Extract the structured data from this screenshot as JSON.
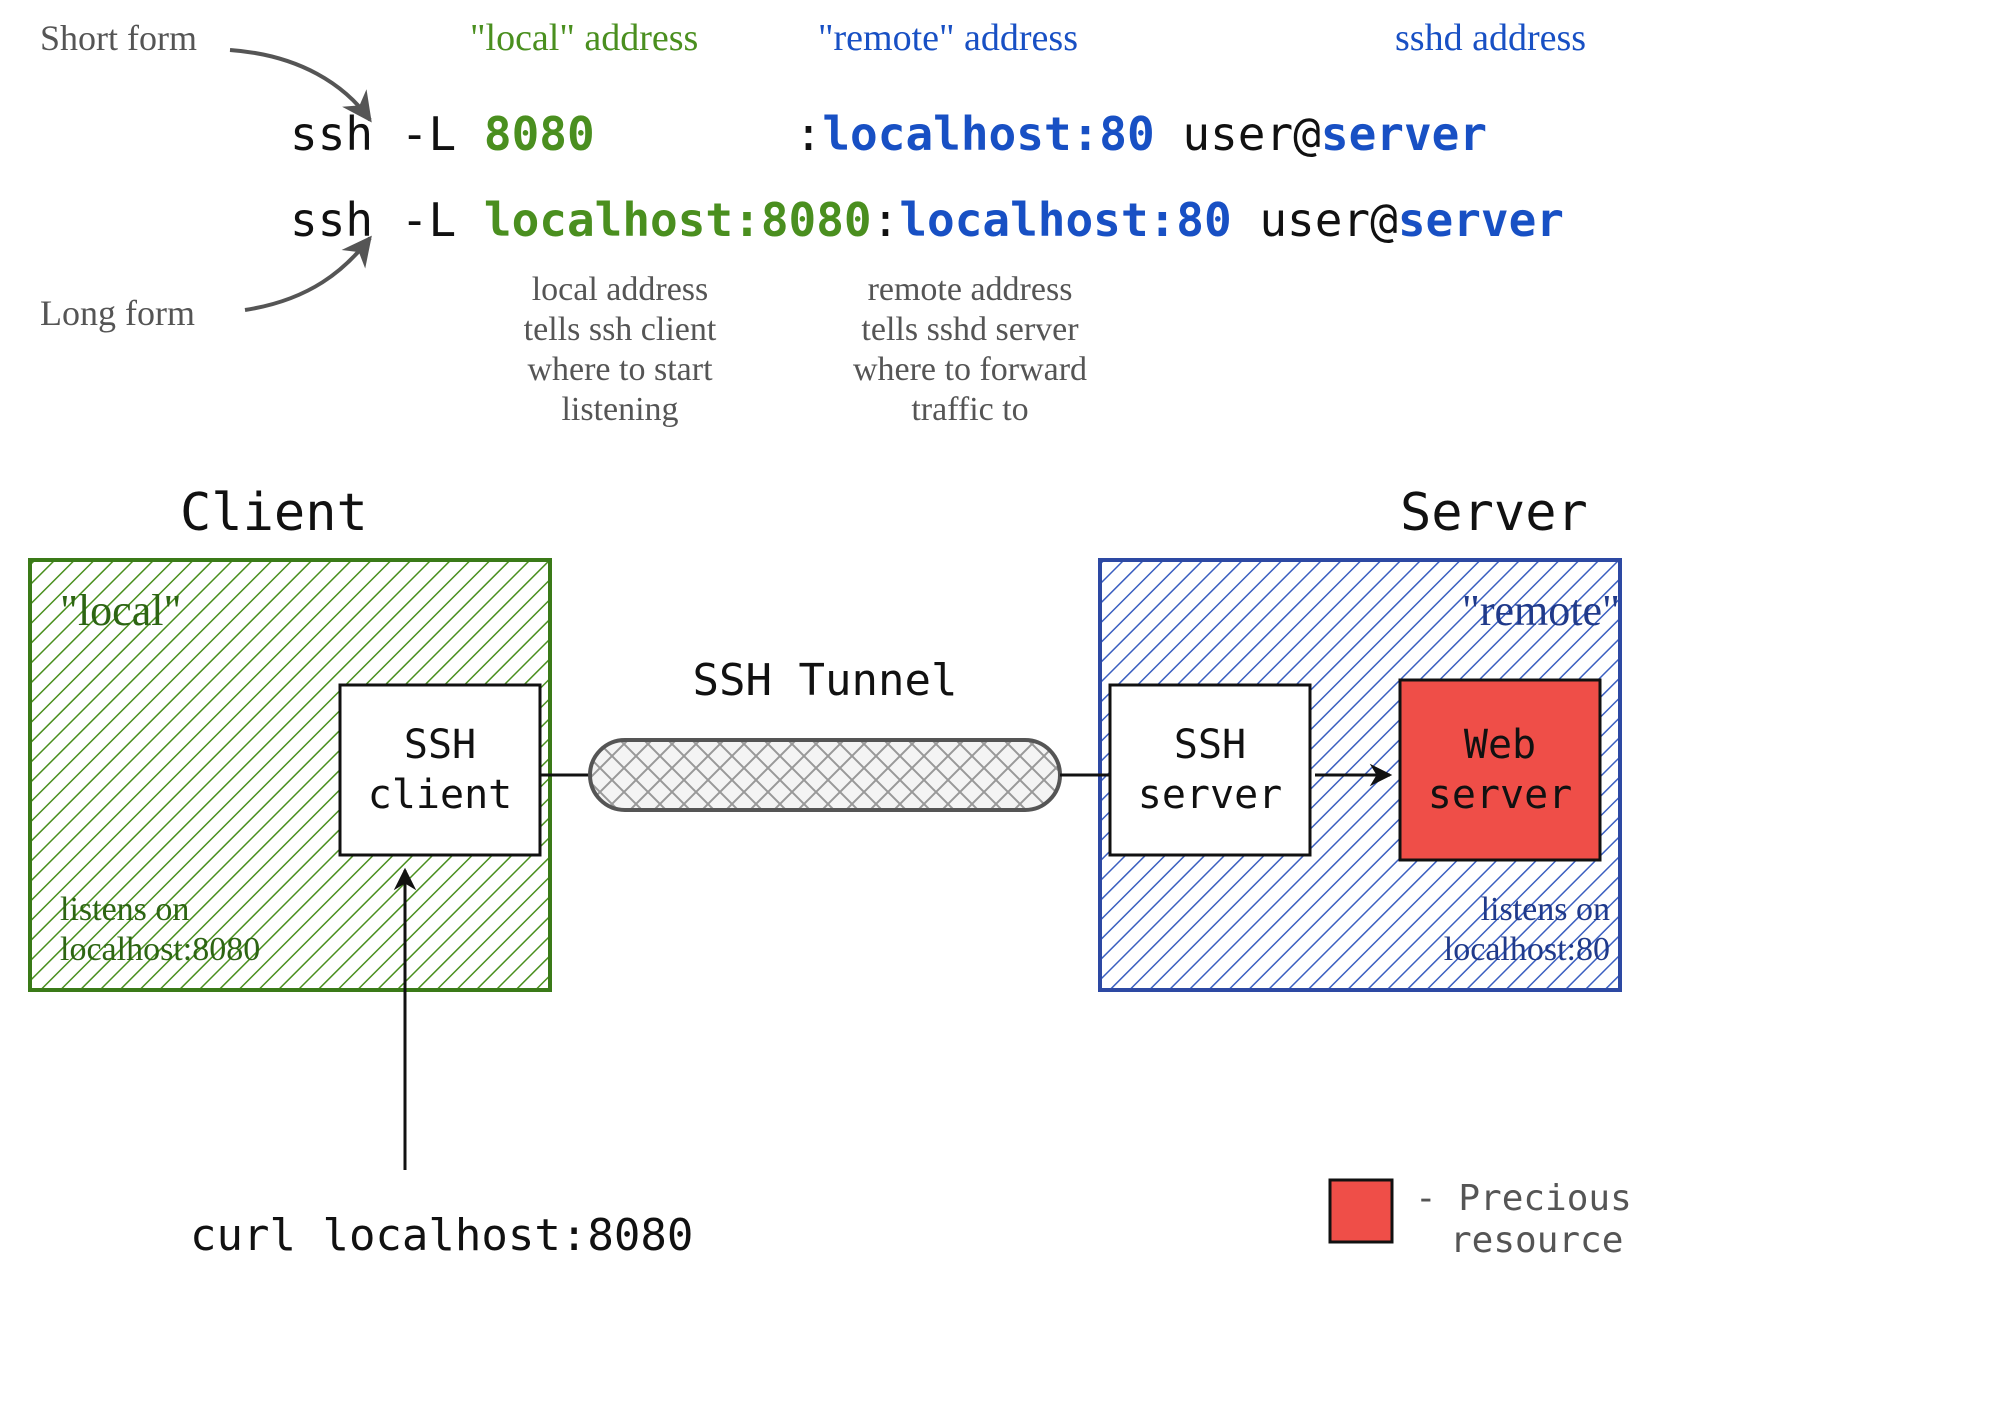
{
  "annot": {
    "short_form": "Short form",
    "long_form": "Long form",
    "local_addr": "\"local\" address",
    "remote_addr": "\"remote\" address",
    "sshd_addr": "sshd address",
    "local_expl_l1": "local address",
    "local_expl_l2": "tells ssh client",
    "local_expl_l3": "where to start",
    "local_expl_l4": "listening",
    "remote_expl_l1": "remote address",
    "remote_expl_l2": "tells sshd server",
    "remote_expl_l3": "where to forward",
    "remote_expl_l4": "traffic to"
  },
  "cmd1": {
    "prefix": "ssh -L ",
    "local": "8080",
    "colon1": ":",
    "remote": "localhost:80",
    "usr": " user@",
    "srv": "server"
  },
  "cmd2": {
    "prefix": "ssh -L ",
    "local": "localhost:8080",
    "colon1": ":",
    "remote": "localhost:80",
    "usr": " user@",
    "srv": "server"
  },
  "diagram": {
    "client_title": "Client",
    "server_title": "Server",
    "local_tag": "\"local\"",
    "remote_tag": "\"remote\"",
    "ssh_tunnel": "SSH Tunnel",
    "ssh_client_l1": "SSH",
    "ssh_client_l2": "client",
    "ssh_server_l1": "SSH",
    "ssh_server_l2": "server",
    "web_l1": "Web",
    "web_l2": "server",
    "client_listen_l1": "listens on",
    "client_listen_l2": "localhost:8080",
    "server_listen_l1": "listens on",
    "server_listen_l2": "localhost:80",
    "curl": "curl localhost:8080"
  },
  "legend": {
    "l1": "- Precious",
    "l2": "resource"
  },
  "colors": {
    "green": "#4a8f1f",
    "blue": "#1850c4",
    "red": "#ef4e48",
    "gray": "#555"
  }
}
